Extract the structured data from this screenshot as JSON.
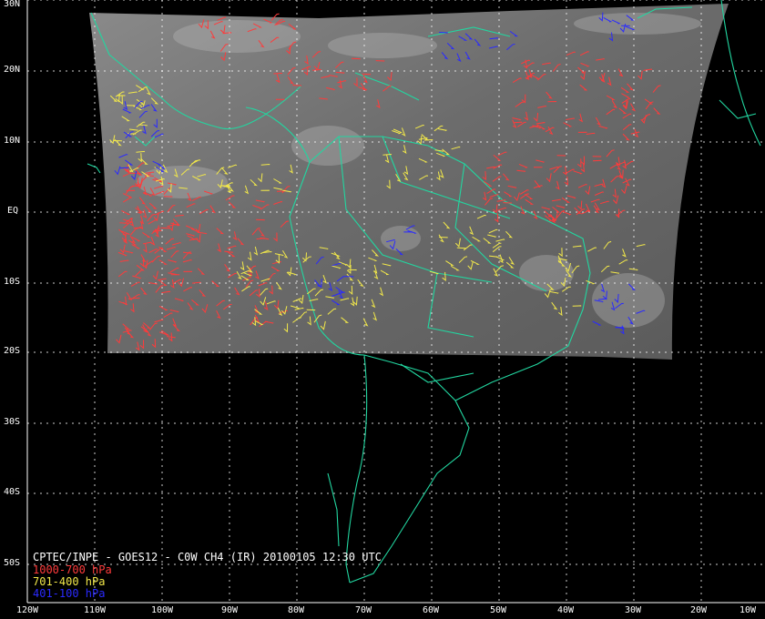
{
  "credit": {
    "title": "CPTEC/INPE - GOES12 - C0W CH4 (IR) 20100105 12:30 UTC",
    "legend": [
      {
        "label": "1000-700 hPa",
        "color": "#ff3b3b"
      },
      {
        "label": "701-400 hPa",
        "color": "#f2e84a"
      },
      {
        "label": "401-100 hPa",
        "color": "#2a2aff"
      }
    ]
  },
  "lat_labels": [
    "30N",
    "20N",
    "10N",
    "EQ",
    "10S",
    "20S",
    "30S",
    "40S",
    "50S"
  ],
  "lon_labels": [
    "120W",
    "110W",
    "100W",
    "90W",
    "80W",
    "70W",
    "60W",
    "50W",
    "40W",
    "30W",
    "20W",
    "10W"
  ],
  "colors": {
    "background": "#000000",
    "grid": "#ffffff",
    "coastline": "#22d6a0",
    "imagery": "#6c6c6c"
  }
}
